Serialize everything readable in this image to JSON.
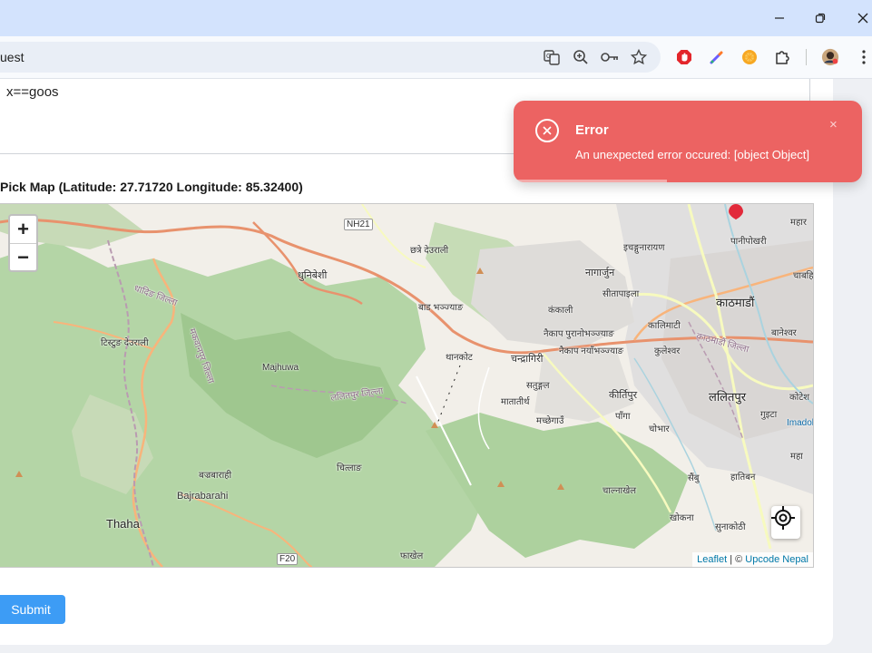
{
  "window": {
    "minimize_icon": "minimize-icon",
    "restore_icon": "restore-icon",
    "close_icon": "close-icon"
  },
  "toolbar": {
    "address_text": "uest",
    "icons": [
      "translate-icon",
      "zoom-icon",
      "key-icon",
      "star-icon",
      "adblock-extension-icon",
      "color-picker-extension-icon",
      "orange-extension-icon",
      "puzzle-icon",
      "avatar",
      "kebab-menu-icon"
    ]
  },
  "form": {
    "textarea_value": "x==goos",
    "map_label": "Pick Map (Latitude: 27.71720 Longitude: 85.32400)",
    "submit_label": "Submit"
  },
  "map": {
    "zoom_in_label": "+",
    "zoom_out_label": "−",
    "attribution_leaflet": "Leaflet",
    "attribution_sep": " | © ",
    "attribution_provider": "Upcode Nepal",
    "place_labels": {
      "nh21": "NH21",
      "chhatre_deurali": "छत्रे देउराली",
      "dhunibeshi": "धुनिबेशी",
      "dhading": "धादिङ जिल्ला",
      "tistung": "टिस्टुङ देउराली",
      "makwanpur": "मकवानपुर जिल्ला",
      "majhuwa": "Majhuwa",
      "bad_bhanjyang": "बाड भञ्ज्याङ",
      "ichangu": "इचङ्गुनारायण",
      "nagarjun": "नागार्जुन",
      "sitapaila": "सीतापाइला",
      "kathmandu": "काठमाडौं",
      "panipokhari": "पानीपोखरी",
      "kankali": "कंकाली",
      "naikap_purano": "नैकाप पुरानोभञ्ज्याङ",
      "kalimati": "कालिमाटी",
      "baneshwor": "बानेश्वर",
      "naikap_naya": "नैकाप नयाँभञ्ज्याङ",
      "kuleshwor": "कुलेश्वर",
      "thankot": "थानकोट",
      "chandragiri": "चन्द्रागिरी",
      "satungal": "सतुङ्गल",
      "kirtipur": "कीर्तिपुर",
      "lalitpur": "ललितपुर",
      "matatirtha": "मातातीर्थ",
      "machhegaun": "मच्छेगाउँ",
      "panga": "पाँगा",
      "chobhar": "चोभार",
      "gwarko": "गुइटा",
      "chitlang": "चित्लाङ",
      "bajrabarahi_ne": "बज्रबाराही",
      "bajrabarahi": "Bajrabarahi",
      "sainbu": "सैंबु",
      "hatiban": "हातिबन",
      "chalnakhel": "चाल्नाखेल",
      "thaha": "Thaha",
      "khokana": "खोकना",
      "sunakothi": "सुनाकोठी",
      "f20": "F20",
      "phakhel": "फाखेल",
      "kotesh": "कोटेश",
      "mahar": "महार",
      "chabahil": "चाबहि",
      "mahara": "महा",
      "imadol": "Imadol",
      "lalitpur_dist": "ललितपुर जिल्ला",
      "kathmandu_dist": "काठमाडौं जिल्ला"
    },
    "colors": {
      "forest": "#add19e",
      "land": "#f2efe9",
      "urban": "#e0dfdf",
      "primary_road": "#f8b47b",
      "trunk_road": "#e8926d",
      "secondary_road": "#f7fabf",
      "boundary": "#b99bb1"
    }
  },
  "toast": {
    "title": "Error",
    "message": "An unexpected error occured: [object Object]",
    "close_label": "×",
    "progress": 0.44,
    "background": "#ec6362"
  }
}
